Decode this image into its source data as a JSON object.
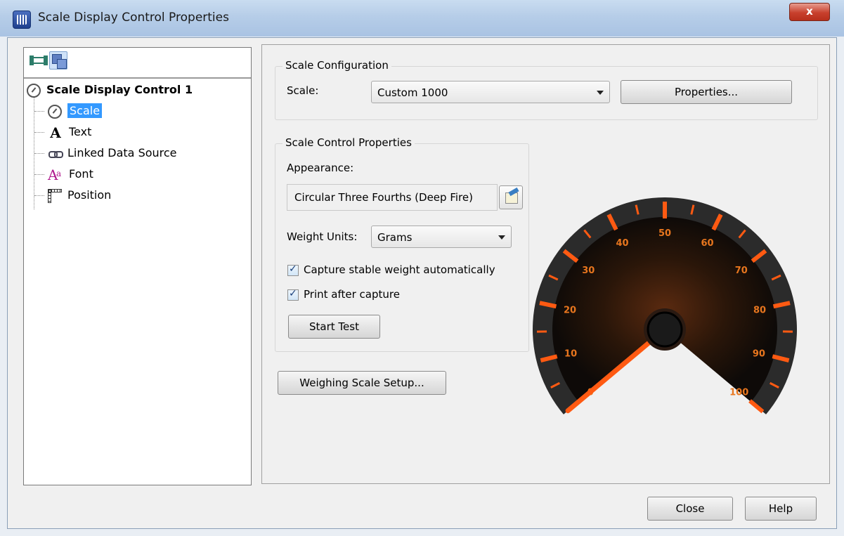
{
  "window": {
    "title": "Scale Display Control Properties",
    "close_glyph": "x",
    "icon": "app-grid-icon"
  },
  "toolbar": {
    "buttons": [
      {
        "icon": "object-nodes-icon"
      },
      {
        "icon": "layers-icon"
      }
    ]
  },
  "tree": {
    "root": {
      "label": "Scale Display Control 1",
      "icon": "gauge-icon"
    },
    "children": [
      {
        "label": "Scale",
        "icon": "gauge-icon",
        "selected": true
      },
      {
        "label": "Text",
        "icon": "text-A-icon"
      },
      {
        "label": "Linked Data Source",
        "icon": "link-icon"
      },
      {
        "label": "Font",
        "icon": "font-icon"
      },
      {
        "label": "Position",
        "icon": "ruler-position-icon"
      }
    ]
  },
  "scale_configuration": {
    "title": "Scale Configuration",
    "scale_label": "Scale:",
    "scale_value": "Custom 1000",
    "properties_button": "Properties..."
  },
  "scale_control_properties": {
    "title": "Scale Control Properties",
    "appearance_label": "Appearance:",
    "appearance_value": "Circular Three Fourths (Deep Fire)",
    "weight_units_label": "Weight Units:",
    "weight_units_value": "Grams",
    "capture_checkbox": {
      "label": "Capture stable weight automatically",
      "checked": true
    },
    "print_checkbox": {
      "label": "Print after capture",
      "checked": true
    },
    "start_test_button": "Start Test"
  },
  "weighing_scale_setup_button": "Weighing Scale Setup...",
  "gauge": {
    "ticks": [
      "0",
      "10",
      "20",
      "30",
      "40",
      "50",
      "60",
      "70",
      "80",
      "90",
      "100"
    ],
    "needle_value": 0,
    "colors": {
      "accent": "#ff5a12",
      "face": "#1a1310",
      "rim": "#2b2b2b",
      "tick_text": "#e8761e"
    }
  },
  "footer": {
    "close_button": "Close",
    "help_button": "Help"
  }
}
